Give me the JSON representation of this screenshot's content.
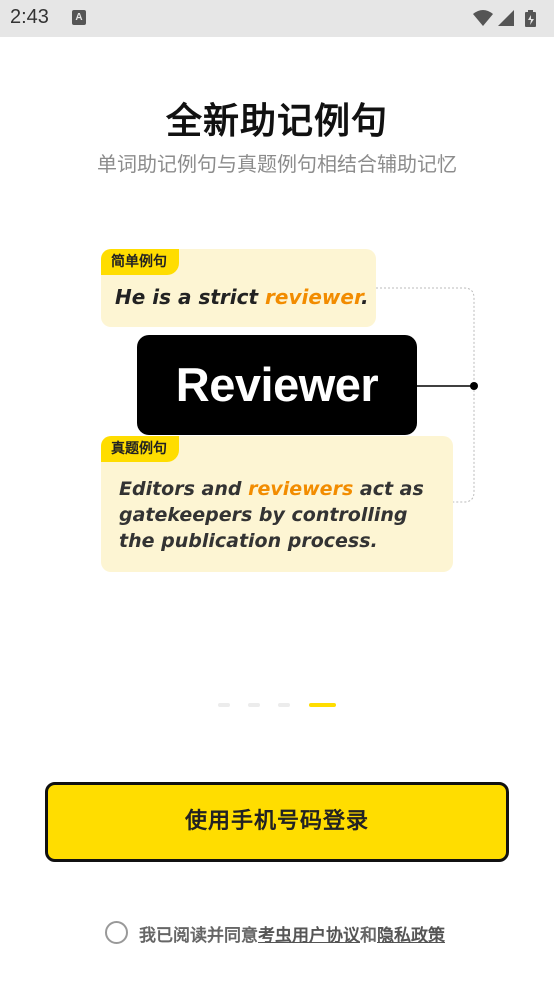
{
  "status_bar": {
    "time": "2:43",
    "notification_icon": "A",
    "icons": [
      "wifi-icon",
      "signal-icon",
      "battery-charging-icon"
    ]
  },
  "onboarding": {
    "title": "全新助记例句",
    "subtitle": "单词助记例句与真题例句相结合辅助记忆",
    "simple_tag": "简单例句",
    "simple_sentence": {
      "before": "He is a strict ",
      "highlight": "reviewer",
      "after": "."
    },
    "word": "Reviewer",
    "real_tag": "真题例句",
    "real_sentence": {
      "before": "Editors and ",
      "highlight": "reviewers",
      "after": " act as gatekeepers by controlling the publication process."
    },
    "page_indicator": {
      "total": 4,
      "current": 4
    }
  },
  "login_button": "使用手机号码登录",
  "agreement": {
    "prefix": "我已阅读并同意",
    "user_agreement": "考虫用户协议",
    "conjunction": "和",
    "privacy_policy": "隐私政策",
    "checked": false
  },
  "colors": {
    "accent": "#ffdd00",
    "highlight": "#f28c00",
    "card_background": "#fdf5d3"
  }
}
